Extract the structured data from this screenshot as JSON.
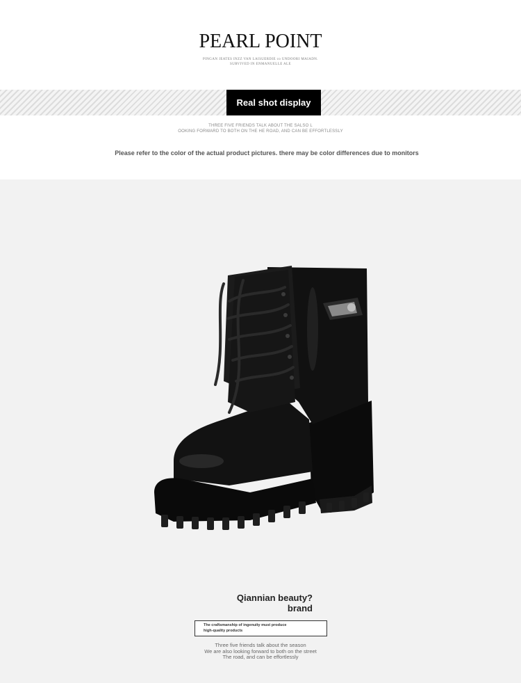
{
  "header": {
    "brand_name": "PEARL POINT",
    "tagline_line1": "PINGAN JEATES INZZ VAN LAISUERDIE co UNDOORI MAIADN.",
    "tagline_line2": "SURVIVED IN ENMANUELLE ALE"
  },
  "section": {
    "badge_label": "Real shot display",
    "sub_line1": "THREE FIVE FRIENDS TALK ABOUT THE SALSO L",
    "sub_line2": "OOKING FORWARD TO BOTH ON THE HE ROAD, AND CAN BE EFFORTLESSLY",
    "color_notice": "Please refer to the color of the actual product pictures. there may be color differences due to monitors"
  },
  "product": {
    "image_name": "black-leather-lace-up-platform-ankle-boot",
    "colors": {
      "leather": "#0d0d0d",
      "background": "#f2f2f2"
    }
  },
  "brand": {
    "question": "Qiannian beauty?",
    "word": "brand",
    "craft_line1": "The craftsmanship of ingenuity must produce",
    "craft_line2": "high-quality products",
    "season_line1": "Three five friends talk about the season",
    "season_line2": "We are also looking forward to both on the street",
    "season_line3": "The road, and can be effortlessly"
  }
}
